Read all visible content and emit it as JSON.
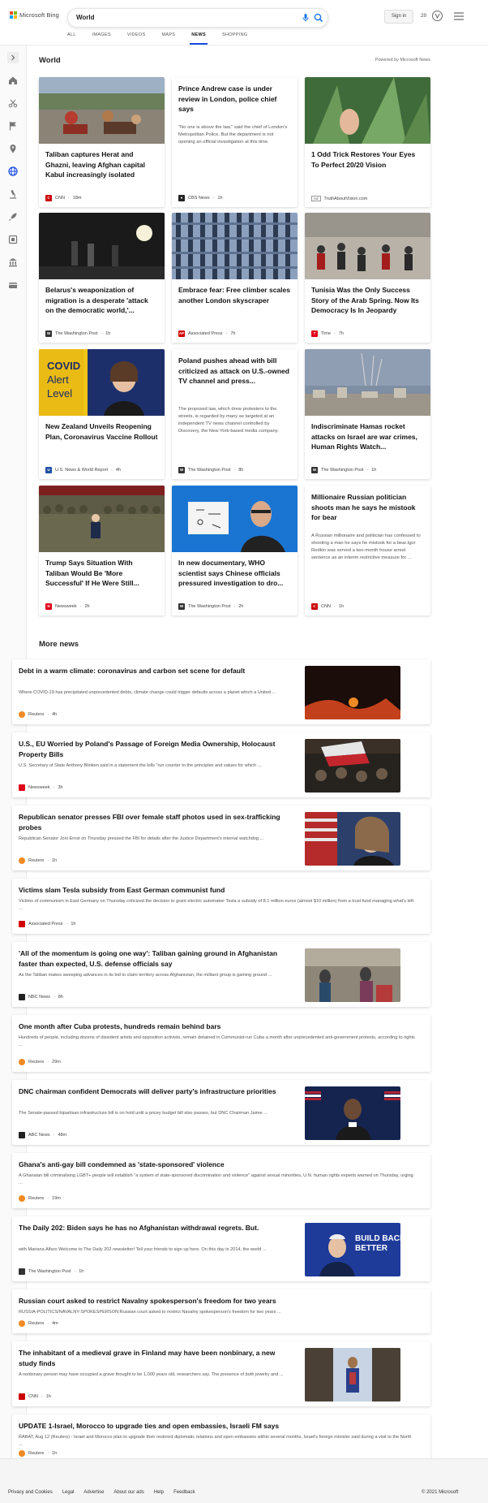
{
  "brand": {
    "name": "Microsoft Bing",
    "colors": [
      "#f25022",
      "#7fba00",
      "#00a4ef",
      "#ffb900"
    ]
  },
  "search": {
    "query": "World"
  },
  "header": {
    "sign_in": "Sign in",
    "rewards_count": "20"
  },
  "tabs": [
    {
      "label": "ALL"
    },
    {
      "label": "IMAGES"
    },
    {
      "label": "VIDEOS"
    },
    {
      "label": "MAPS"
    },
    {
      "label": "NEWS",
      "active": true
    },
    {
      "label": "SHOPPING"
    }
  ],
  "accent": "#174ae4",
  "rail_icons": [
    "chevron-right-icon",
    "home-icon",
    "scissors-icon",
    "flag-icon",
    "location-icon",
    "globe-icon",
    "microscope-icon",
    "rocket-icon",
    "film-icon",
    "bank-icon",
    "card-icon"
  ],
  "section": {
    "title": "World",
    "powered_by": "Powered by Microsoft News"
  },
  "cards": [
    {
      "title": "Taliban captures Herat and Ghazni, leaving Afghan capital Kabul increasingly isolated",
      "snippet": "",
      "source": "CNN",
      "time": "18m",
      "src_color": "#cc0000"
    },
    {
      "title": "Prince Andrew case is under review in London, police chief says",
      "snippet": "\"No one is above the law,\" said the chief of London's Metropolitan Police. But the department is not opening an official investigation at this time.",
      "source": "CBS News",
      "time": "1h",
      "src_color": "#222222"
    },
    {
      "title": "1 Odd Trick Restores Your Eyes To Perfect 20/20 Vision",
      "snippet": "",
      "source": "TruthAboutVision.com",
      "time": "",
      "ad": "Ad",
      "src_color": ""
    },
    {
      "title": "Belarus's weaponization of migration is a desperate 'attack on the democratic world,'...",
      "snippet": "",
      "source": "The Washington Post",
      "time": "1h",
      "src_color": "#333333"
    },
    {
      "title": "Embrace fear: Free climber scales another London skyscraper",
      "snippet": "",
      "source": "Associated Press",
      "time": "7h",
      "src_color": "#d10000"
    },
    {
      "title": "Tunisia Was the Only Success Story of the Arab Spring. Now Its Democracy Is In Jeopardy",
      "snippet": "",
      "source": "Time",
      "time": "7h",
      "src_color": "#e2001a"
    },
    {
      "title": "New Zealand Unveils Reopening Plan, Coronavirus Vaccine Rollout",
      "snippet": "",
      "source": "U.S. News & World Report",
      "time": "4h",
      "src_color": "#1f4fa3"
    },
    {
      "title": "Poland pushes ahead with bill criticized as attack on U.S.-owned TV channel and press...",
      "snippet": "The proposed law, which drew protesters to the streets, is regarded by many as targeted at an independent TV news channel controlled by Discovery, the New York-based media company.",
      "source": "The Washington Post",
      "time": "8h",
      "src_color": "#333333"
    },
    {
      "title": "Indiscriminate Hamas rocket attacks on Israel are war crimes, Human Rights Watch...",
      "snippet": "",
      "source": "The Washington Post",
      "time": "1h",
      "src_color": "#333333"
    },
    {
      "title": "Trump Says Situation With Taliban Would Be 'More Successful' If He Were Still...",
      "snippet": "",
      "source": "Newsweek",
      "time": "2h",
      "src_color": "#e0001b"
    },
    {
      "title": "In new documentary, WHO scientist says Chinese officials pressured investigation to dro...",
      "snippet": "",
      "source": "The Washington Post",
      "time": "2h",
      "src_color": "#333333"
    },
    {
      "title": "Millionaire Russian politician shoots man he says he mistook for bear",
      "snippet": "A Russian millionaire and politician has confessed to shooting a man he says he mistook for a bear.Igor Redkin was served a two-month house arrest sentence as an interim restrictive measure for ...",
      "source": "CNN",
      "time": "1h",
      "src_color": "#cc0000"
    }
  ],
  "more_news": {
    "title": "More news",
    "items": [
      {
        "title": "Debt in a warm climate: coronavirus and carbon set scene for default",
        "snippet": "Where COVID-19 has precipitated unprecedented debts, climate change could trigger defaults across a planet which a United ...",
        "source": "Reuters",
        "time": "4h",
        "has_image": true,
        "src_color": "#f08a24"
      },
      {
        "title": "U.S., EU Worried by Poland's Passage of Foreign Media Ownership, Holocaust Property Bills",
        "snippet": "U.S. Secretary of State Anthony Blinken said in a statement the bills \"run counter to the principles and values for which ...",
        "source": "Newsweek",
        "time": "3h",
        "has_image": true,
        "src_color": "#e0001b"
      },
      {
        "title": "Republican senator presses FBI over female staff photos used in sex-trafficking probes",
        "snippet": "Republican Senator Joni Ernst on Thursday pressed the FBI for details after the Justice Department's internal watchdog ...",
        "source": "Reuters",
        "time": "1h",
        "has_image": true,
        "src_color": "#f08a24"
      },
      {
        "title": "Victims slam Tesla subsidy from East German communist fund",
        "snippet": "Victims of communism in East Germany on Thursday criticized the decision to grant electric automaker Tesla a subsidy of 8.1 million euros (almost $10 million) from a trust fund managing what's left ...",
        "source": "Associated Press",
        "time": "1h",
        "has_image": false,
        "src_color": "#d10000"
      },
      {
        "title": "'All of the momentum is going one way': Taliban gaining ground in Afghanistan faster than expected, U.S. defense officials say",
        "snippet": "As the Taliban makes sweeping advances in its bid to claim territory across Afghanistan, the militant group is gaining ground ...",
        "source": "NBC News",
        "time": "8h",
        "has_image": true,
        "src_color": "#222222"
      },
      {
        "title": "One month after Cuba protests, hundreds remain behind bars",
        "snippet": "Hundreds of people, including dozens of dissident artists and opposition activists, remain detained in Communist-run Cuba a month after unprecedented anti-government protests, according to rights ...",
        "source": "Reuters",
        "time": "29m",
        "has_image": false,
        "src_color": "#f08a24"
      },
      {
        "title": "DNC chairman confident Democrats will deliver party's infrastructure priorities",
        "snippet": "The Senate-passed bipartisan infrastructure bill is on hold until a pricey budget bill also passes, but DNC Chairman Jaime ...",
        "source": "ABC News",
        "time": "48m",
        "has_image": true,
        "src_color": "#222222"
      },
      {
        "title": "Ghana's anti-gay bill condemned as 'state-sponsored' violence",
        "snippet": "A Ghanaian bill criminalising LGBT+ people will establish \"a system of state-sponsored discrimination and violence\" against sexual minorities, U.N. human rights experts warned on Thursday, urging ...",
        "source": "Reuters",
        "time": "19m",
        "has_image": false,
        "src_color": "#f08a24"
      },
      {
        "title": "The Daily 202: Biden says he has no Afghanistan withdrawal regrets. But.",
        "snippet": "with Mariana Alfaro Welcome to The Daily 202 newsletter! Tell your friends to sign up here. On this day in 2014, the world ...",
        "source": "The Washington Post",
        "time": "1h",
        "has_image": true,
        "image_text": "BUILD BACK BETTER",
        "src_color": "#333333"
      },
      {
        "title": "Russian court asked to restrict Navalny spokesperson's freedom for two years",
        "snippet": "RUSSIA-POLITICS/NAVALNY-SPOKESPERSON:Russian court asked to restrict Navalny spokesperson's freedom for two years ...",
        "source": "Reuters",
        "time": "4m",
        "has_image": false,
        "src_color": "#f08a24"
      },
      {
        "title": "The inhabitant of a medieval grave in Finland may have been nonbinary, a new study finds",
        "snippet": "A nonbinary person may have occupied a grave thought to be 1,000 years old, researchers say. The presence of both jewelry and ...",
        "source": "CNN",
        "time": "1h",
        "has_image": true,
        "src_color": "#cc0000"
      },
      {
        "title": "UPDATE 1-Israel, Morocco to upgrade ties and open embassies, Israeli FM says",
        "snippet": "RABAT, Aug 12 (Reuters) - Israel and Morocco plan to upgrade their restored diplomatic relations and open embassies within several months, Israel's foreign minister said during a visit to the North ...",
        "source": "Reuters",
        "time": "1h",
        "has_image": false,
        "src_color": "#f08a24"
      }
    ]
  },
  "footer": {
    "links": [
      "Privacy and Cookies",
      "Legal",
      "Advertise",
      "About our ads",
      "Help",
      "Feedback"
    ],
    "copyright": "© 2021 Microsoft"
  },
  "card_image_text": {
    "covid": "COVID Alert Level"
  }
}
